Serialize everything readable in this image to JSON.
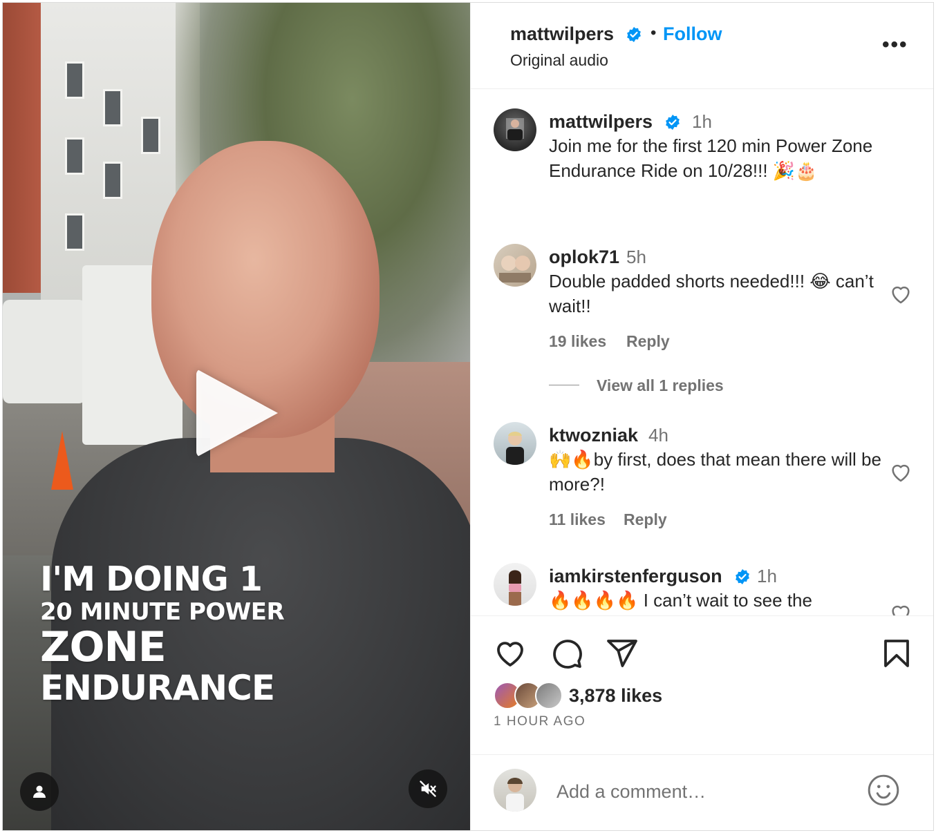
{
  "video": {
    "caption_line1": "I'M DOING 1",
    "caption_line2": "20 MINUTE POWER",
    "caption_line3": "ZONE",
    "caption_line4": "ENDURANCE"
  },
  "header": {
    "username": "mattwilpers",
    "separator": "•",
    "follow_label": "Follow",
    "audio": "Original audio",
    "more_label": "•••"
  },
  "caption_post": {
    "username": "mattwilpers",
    "time": "1h",
    "text": "Join me for the first 120 min Power Zone Endurance Ride on 10/28!!! 🎉🎂"
  },
  "comments": [
    {
      "username": "oplok71",
      "time": "5h",
      "text": "Double padded shorts needed!!! 😂 can’t wait!!",
      "likes": "19 likes",
      "reply_label": "Reply",
      "view_replies": "View all 1 replies"
    },
    {
      "username": "ktwozniak",
      "time": "4h",
      "text": "🙌🔥by first, does that mean there will be more?!",
      "likes": "11 likes",
      "reply_label": "Reply"
    },
    {
      "username": "iamkirstenferguson",
      "time": "1h",
      "text": "🔥🔥🔥🔥 I can’t wait to see the"
    }
  ],
  "actions": {
    "likes_count": "3,878 likes",
    "posted": "1 HOUR AGO",
    "add_comment_placeholder": "Add a comment…"
  },
  "icons": {
    "verified": "verified-badge-icon",
    "heart": "heart-icon",
    "comment": "comment-icon",
    "share": "share-icon",
    "save": "bookmark-icon",
    "emoji": "emoji-icon",
    "play": "play-icon",
    "mute": "muted-speaker-icon",
    "tag": "user-tag-icon"
  },
  "colors": {
    "accent": "#0095f6",
    "text": "#262626",
    "muted": "#737373"
  }
}
